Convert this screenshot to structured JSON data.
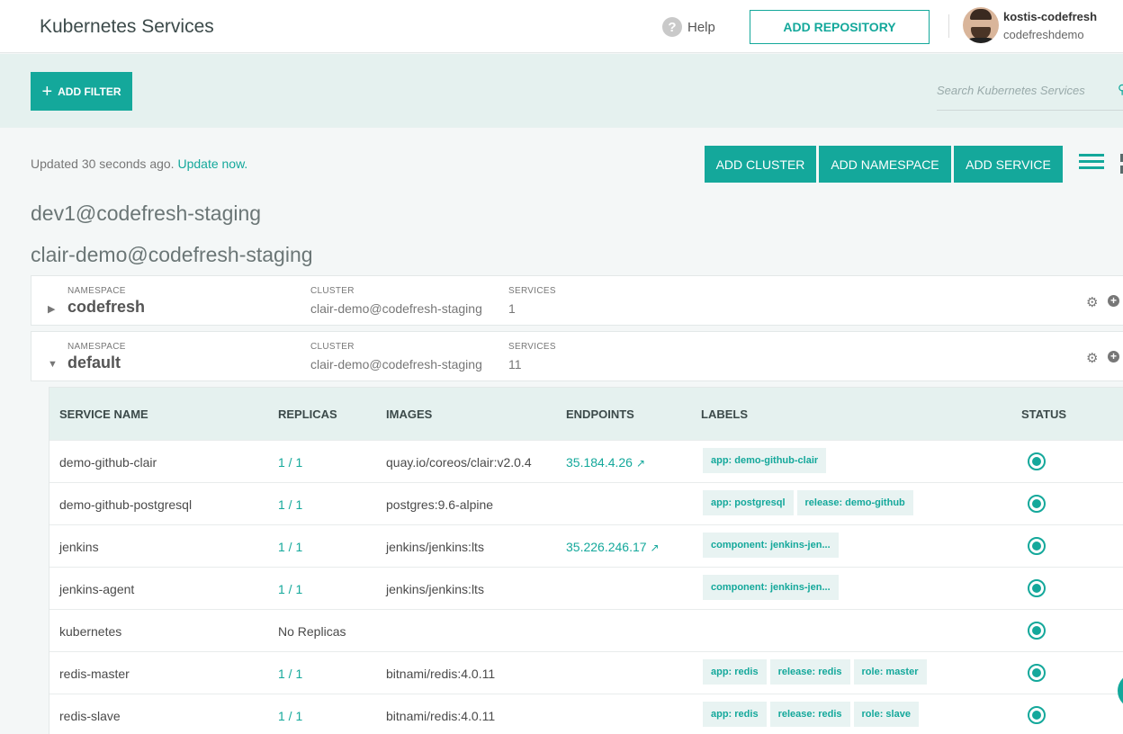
{
  "header": {
    "title": "Kubernetes Services",
    "help_label": "Help",
    "add_repository_label": "ADD REPOSITORY",
    "user": {
      "name": "kostis-codefresh",
      "org": "codefreshdemo"
    }
  },
  "filters": {
    "add_filter_label": "ADD FILTER",
    "search_placeholder": "Search Kubernetes Services",
    "search_value": ""
  },
  "toolbar": {
    "updated_text": "Updated 30 seconds ago.",
    "update_now_label": "Update now.",
    "add_cluster_label": "ADD CLUSTER",
    "add_namespace_label": "ADD NAMESPACE",
    "add_service_label": "ADD SERVICE"
  },
  "clusters": [
    {
      "title": "dev1@codefresh-staging"
    },
    {
      "title": "clair-demo@codefresh-staging"
    }
  ],
  "namespaces": [
    {
      "namespace_label": "NAMESPACE",
      "name": "codefresh",
      "cluster_label": "CLUSTER",
      "cluster": "clair-demo@codefresh-staging",
      "services_label": "SERVICES",
      "services": "1",
      "expanded": false
    },
    {
      "namespace_label": "NAMESPACE",
      "name": "default",
      "cluster_label": "CLUSTER",
      "cluster": "clair-demo@codefresh-staging",
      "services_label": "SERVICES",
      "services": "11",
      "expanded": true
    }
  ],
  "services_table": {
    "columns": [
      "SERVICE NAME",
      "REPLICAS",
      "IMAGES",
      "ENDPOINTS",
      "LABELS",
      "STATUS"
    ],
    "rows": [
      {
        "name": "demo-github-clair",
        "replicas": "1 / 1",
        "image": "quay.io/coreos/clair:v2.0.4",
        "endpoint": "35.184.4.26",
        "labels": [
          "app: demo-github-clair"
        ],
        "status": "running"
      },
      {
        "name": "demo-github-postgresql",
        "replicas": "1 / 1",
        "image": "postgres:9.6-alpine",
        "endpoint": "",
        "labels": [
          "app: postgresql",
          "release: demo-github"
        ],
        "status": "running"
      },
      {
        "name": "jenkins",
        "replicas": "1 / 1",
        "image": "jenkins/jenkins:lts",
        "endpoint": "35.226.246.17",
        "labels": [
          "component: jenkins-jen..."
        ],
        "status": "running"
      },
      {
        "name": "jenkins-agent",
        "replicas": "1 / 1",
        "image": "jenkins/jenkins:lts",
        "endpoint": "",
        "labels": [
          "component: jenkins-jen..."
        ],
        "status": "running"
      },
      {
        "name": "kubernetes",
        "replicas": "No Replicas",
        "image": "",
        "endpoint": "",
        "labels": [],
        "status": "running"
      },
      {
        "name": "redis-master",
        "replicas": "1 / 1",
        "image": "bitnami/redis:4.0.11",
        "endpoint": "",
        "labels": [
          "app: redis",
          "release: redis",
          "role: master"
        ],
        "status": "running"
      },
      {
        "name": "redis-slave",
        "replicas": "1 / 1",
        "image": "bitnami/redis:4.0.11",
        "endpoint": "",
        "labels": [
          "app: redis",
          "release: redis",
          "role: slave"
        ],
        "status": "running"
      }
    ]
  },
  "colors": {
    "accent": "#14a89b",
    "band": "#e5f1ef",
    "background": "#f4f7f7"
  },
  "icons": [
    "help-icon",
    "plus-icon",
    "search-icon",
    "list-view-icon",
    "grid-view-icon",
    "caret-right-icon",
    "caret-down-icon",
    "gear-icon",
    "add-circle-icon",
    "external-link-icon",
    "status-icon"
  ]
}
